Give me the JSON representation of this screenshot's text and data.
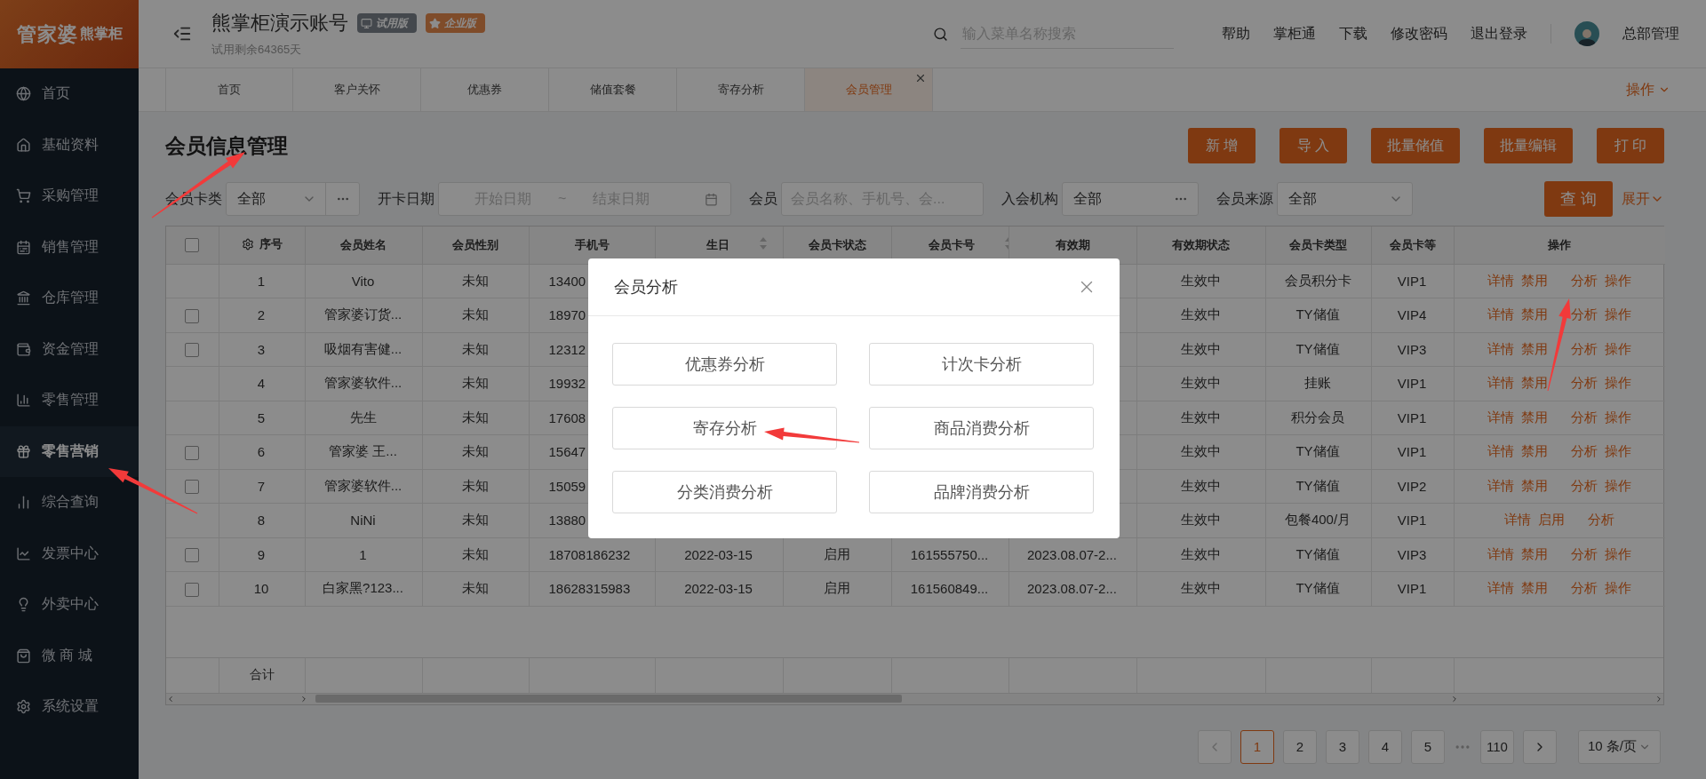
{
  "sidebar": {
    "logo": {
      "brand": "管家婆",
      "product": "熊掌柜"
    },
    "items": [
      {
        "label": "首页",
        "selected": false
      },
      {
        "label": "基础资料",
        "selected": false
      },
      {
        "label": "采购管理",
        "selected": false
      },
      {
        "label": "销售管理",
        "selected": false
      },
      {
        "label": "仓库管理",
        "selected": false
      },
      {
        "label": "资金管理",
        "selected": false
      },
      {
        "label": "零售管理",
        "selected": false
      },
      {
        "label": "零售营销",
        "selected": true
      },
      {
        "label": "综合查询",
        "selected": false
      },
      {
        "label": "发票中心",
        "selected": false
      },
      {
        "label": "外卖中心",
        "selected": false
      },
      {
        "label": "微 商 城",
        "selected": false
      },
      {
        "label": "系统设置",
        "selected": false
      }
    ]
  },
  "header": {
    "account": "熊掌柜演示账号",
    "badges": [
      {
        "kind": "trial",
        "label": "试用版"
      },
      {
        "kind": "enterprise",
        "label": "企业版"
      }
    ],
    "trial_remaining": "试用剩余64365天",
    "search": {
      "placeholder": "输入菜单名称搜索"
    },
    "links": [
      "帮助",
      "掌柜通",
      "下载",
      "修改密码",
      "退出登录"
    ],
    "user": "总部管理"
  },
  "tabs": [
    {
      "label": "首页",
      "selected": false,
      "closable": false
    },
    {
      "label": "客户关怀",
      "selected": false,
      "closable": false
    },
    {
      "label": "优惠券",
      "selected": false,
      "closable": false
    },
    {
      "label": "储值套餐",
      "selected": false,
      "closable": false
    },
    {
      "label": "寄存分析",
      "selected": false,
      "closable": false
    },
    {
      "label": "会员管理",
      "selected": true,
      "closable": true
    }
  ],
  "tab_actions": "操作",
  "page": {
    "title": "会员信息管理",
    "buttons": [
      "新 增",
      "导 入",
      "批量储值",
      "批量编辑",
      "打 印"
    ]
  },
  "filters": [
    {
      "kind": "select",
      "label": "会员卡类",
      "value": "全部",
      "dropdown": true,
      "more": true
    },
    {
      "kind": "date_range",
      "label": "开卡日期",
      "start_placeholder": "开始日期",
      "separator": "~",
      "end_placeholder": "结束日期"
    },
    {
      "kind": "text",
      "label": "会员",
      "placeholder": "会员名称、手机号、会..."
    },
    {
      "kind": "select",
      "label": "入会机构",
      "value": "全部",
      "dropdown": false,
      "more": true
    },
    {
      "kind": "select",
      "label": "会员来源",
      "value": "全部",
      "dropdown": true,
      "more": false
    }
  ],
  "query_button": "查 询",
  "expand_link": "展开",
  "table": {
    "select_all_checked": false,
    "columns": [
      {
        "kind": "check"
      },
      {
        "kind": "index",
        "label": "序号"
      },
      {
        "kind": "plain",
        "label": "会员姓名"
      },
      {
        "kind": "plain",
        "label": "会员性别"
      },
      {
        "kind": "plain",
        "label": "手机号"
      },
      {
        "kind": "sort",
        "label": "生日"
      },
      {
        "kind": "plain",
        "label": "会员卡状态"
      },
      {
        "kind": "sort",
        "label": "会员卡号"
      },
      {
        "kind": "plain",
        "label": "有效期"
      },
      {
        "kind": "plain",
        "label": "有效期状态"
      },
      {
        "kind": "plain",
        "label": "会员卡类型"
      },
      {
        "kind": "plain",
        "label": "会员卡等"
      },
      {
        "kind": "plain",
        "label": "操作"
      }
    ],
    "rows": [
      {
        "selectable": false,
        "index": "1",
        "name": "Vito",
        "gender": "未知",
        "phone": "13400",
        "validity_status": "生效中",
        "card_type": "会员积分卡",
        "card_level": "VIP1",
        "actions": [
          "详情",
          "禁用",
          "分析",
          "操作"
        ]
      },
      {
        "selectable": true,
        "checked": false,
        "index": "2",
        "name": "管家婆订货...",
        "gender": "未知",
        "phone": "18970",
        "validity_status": "生效中",
        "card_type": "TY储值",
        "card_level": "VIP4",
        "actions": [
          "详情",
          "禁用",
          "分析",
          "操作"
        ]
      },
      {
        "selectable": true,
        "checked": false,
        "index": "3",
        "name": "吸烟有害健...",
        "gender": "未知",
        "phone": "12312",
        "validity_status": "生效中",
        "card_type": "TY储值",
        "card_level": "VIP3",
        "actions": [
          "详情",
          "禁用",
          "分析",
          "操作"
        ]
      },
      {
        "selectable": false,
        "index": "4",
        "name": "管家婆软件...",
        "gender": "未知",
        "phone": "19932",
        "validity_status": "生效中",
        "card_type": "挂账",
        "card_level": "VIP1",
        "actions": [
          "详情",
          "禁用",
          "分析",
          "操作"
        ]
      },
      {
        "selectable": false,
        "index": "5",
        "name": "先生",
        "gender": "未知",
        "phone": "17608",
        "validity_status": "生效中",
        "card_type": "积分会员",
        "card_level": "VIP1",
        "actions": [
          "详情",
          "禁用",
          "分析",
          "操作"
        ]
      },
      {
        "selectable": true,
        "checked": false,
        "index": "6",
        "name": "管家婆 王...",
        "gender": "未知",
        "phone": "15647",
        "validity_status": "生效中",
        "card_type": "TY储值",
        "card_level": "VIP1",
        "actions": [
          "详情",
          "禁用",
          "分析",
          "操作"
        ]
      },
      {
        "selectable": true,
        "checked": false,
        "index": "7",
        "name": "管家婆软件...",
        "gender": "未知",
        "phone": "15059",
        "validity_status": "生效中",
        "card_type": "TY储值",
        "card_level": "VIP2",
        "actions": [
          "详情",
          "禁用",
          "分析",
          "操作"
        ]
      },
      {
        "selectable": false,
        "index": "8",
        "name": "NiNi",
        "gender": "未知",
        "phone": "13880",
        "validity_status": "生效中",
        "card_type": "包餐400/月",
        "card_level": "VIP1",
        "actions": [
          "详情",
          "启用",
          "分析"
        ]
      },
      {
        "selectable": true,
        "checked": false,
        "index": "9",
        "name": "1",
        "gender": "未知",
        "phone": "18708186232",
        "birthday": "2022-03-15",
        "card_status": "启用",
        "card_no": "161555750...",
        "validity": "2023.08.07-2...",
        "validity_status": "生效中",
        "card_type": "TY储值",
        "card_level": "VIP3",
        "actions": [
          "详情",
          "禁用",
          "分析",
          "操作"
        ]
      },
      {
        "selectable": true,
        "checked": false,
        "index": "10",
        "name": "白家黑?123...",
        "gender": "未知",
        "phone": "18628315983",
        "birthday": "2022-03-15",
        "card_status": "启用",
        "card_no": "161560849...",
        "validity": "2023.08.07-2...",
        "validity_status": "生效中",
        "card_type": "TY储值",
        "card_level": "VIP1",
        "actions": [
          "详情",
          "禁用",
          "分析",
          "操作"
        ]
      }
    ],
    "total_label": "合计"
  },
  "pagination": {
    "pages": [
      {
        "label": "1",
        "selected": true
      },
      {
        "label": "2",
        "selected": false
      },
      {
        "label": "3",
        "selected": false
      },
      {
        "label": "4",
        "selected": false
      },
      {
        "label": "5",
        "selected": false
      },
      {
        "label": "110",
        "selected": false
      }
    ],
    "page_size": "10 条/页"
  },
  "dialog": {
    "title": "会员分析",
    "options": [
      "优惠券分析",
      "计次卡分析",
      "寄存分析",
      "商品消费分析",
      "分类消费分析",
      "品牌消费分析"
    ]
  }
}
